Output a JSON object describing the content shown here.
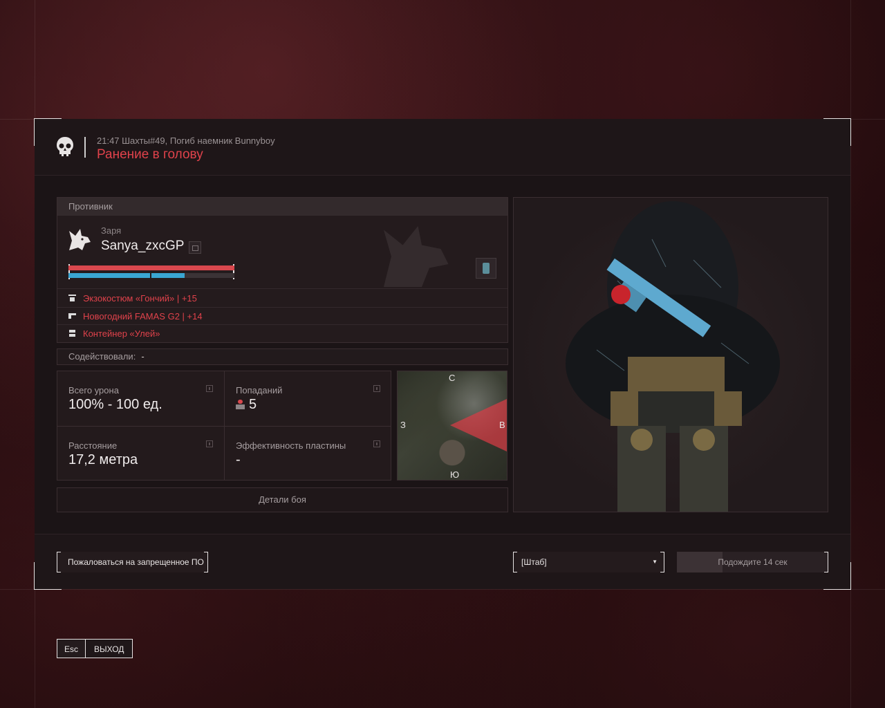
{
  "header": {
    "subtitle": "21:47 Шахты#49, Погиб наемник Bunnyboy",
    "title": "Ранение в голову"
  },
  "enemy": {
    "section_label": "Противник",
    "clan": "Заря",
    "nickname": "Sanya_zxcGP",
    "health_fraction": 1.0,
    "armor_fraction": 0.7,
    "gear": [
      {
        "icon": "exosuit-icon",
        "label": "Экзокостюм «Гончий» | +15"
      },
      {
        "icon": "rifle-icon",
        "label": "Новогодний FAMAS G2 | +14"
      },
      {
        "icon": "container-icon",
        "label": "Контейнер «Улей»"
      }
    ]
  },
  "assist": {
    "label": "Содействовали:",
    "value": "-"
  },
  "stats": {
    "damage": {
      "label": "Всего урона",
      "value": "100% - 100 ед."
    },
    "hits": {
      "label": "Попаданий",
      "value": "5"
    },
    "distance": {
      "label": "Расстояние",
      "value": "17,2 метра"
    },
    "plate": {
      "label": "Эффективность пластины",
      "value": "-"
    }
  },
  "minimap": {
    "north": "С",
    "south": "Ю",
    "west": "З",
    "east": "В"
  },
  "details_button": "Детали боя",
  "footer": {
    "report_button": "Пожаловаться на запрещенное ПО",
    "server_select": "[Штаб]",
    "wait_button": "Подождите 14 сек",
    "wait_progress": 0.3
  },
  "exit": {
    "key": "Esc",
    "label": "ВЫХОД"
  },
  "colors": {
    "accent_red": "#e0424b",
    "health": "#d9484e",
    "armor": "#3aa6d2"
  }
}
